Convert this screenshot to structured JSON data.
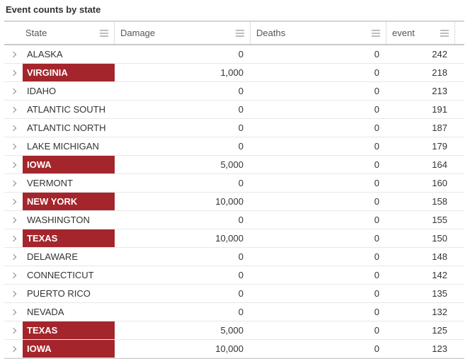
{
  "title": "Event counts by state",
  "columns": {
    "state": "State",
    "damage": "Damage",
    "deaths": "Deaths",
    "event": "event"
  },
  "rows": [
    {
      "state": "ALASKA",
      "damage": "0",
      "deaths": "0",
      "event": "242",
      "highlight": false
    },
    {
      "state": "VIRGINIA",
      "damage": "1,000",
      "deaths": "0",
      "event": "218",
      "highlight": true
    },
    {
      "state": "IDAHO",
      "damage": "0",
      "deaths": "0",
      "event": "213",
      "highlight": false
    },
    {
      "state": "ATLANTIC SOUTH",
      "damage": "0",
      "deaths": "0",
      "event": "191",
      "highlight": false
    },
    {
      "state": "ATLANTIC NORTH",
      "damage": "0",
      "deaths": "0",
      "event": "187",
      "highlight": false
    },
    {
      "state": "LAKE MICHIGAN",
      "damage": "0",
      "deaths": "0",
      "event": "179",
      "highlight": false
    },
    {
      "state": "IOWA",
      "damage": "5,000",
      "deaths": "0",
      "event": "164",
      "highlight": true
    },
    {
      "state": "VERMONT",
      "damage": "0",
      "deaths": "0",
      "event": "160",
      "highlight": false
    },
    {
      "state": "NEW YORK",
      "damage": "10,000",
      "deaths": "0",
      "event": "158",
      "highlight": true
    },
    {
      "state": "WASHINGTON",
      "damage": "0",
      "deaths": "0",
      "event": "155",
      "highlight": false
    },
    {
      "state": "TEXAS",
      "damage": "10,000",
      "deaths": "0",
      "event": "150",
      "highlight": true
    },
    {
      "state": "DELAWARE",
      "damage": "0",
      "deaths": "0",
      "event": "148",
      "highlight": false
    },
    {
      "state": "CONNECTICUT",
      "damage": "0",
      "deaths": "0",
      "event": "142",
      "highlight": false
    },
    {
      "state": "PUERTO RICO",
      "damage": "0",
      "deaths": "0",
      "event": "135",
      "highlight": false
    },
    {
      "state": "NEVADA",
      "damage": "0",
      "deaths": "0",
      "event": "132",
      "highlight": false
    },
    {
      "state": "TEXAS",
      "damage": "5,000",
      "deaths": "0",
      "event": "125",
      "highlight": true
    },
    {
      "state": "IOWA",
      "damage": "10,000",
      "deaths": "0",
      "event": "123",
      "highlight": true
    }
  ]
}
